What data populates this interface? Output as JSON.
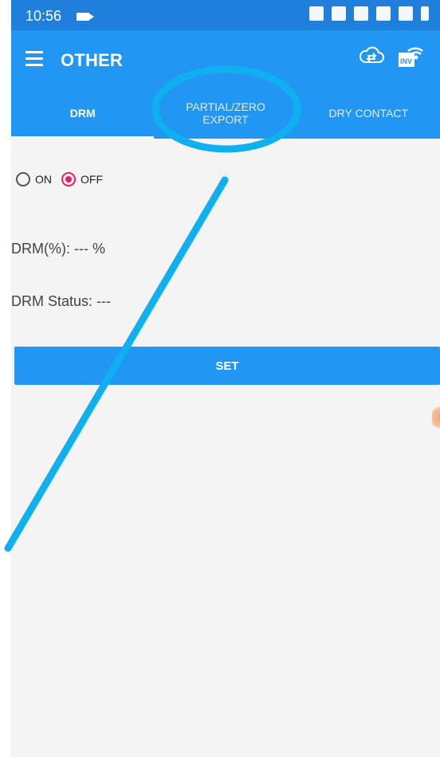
{
  "status_bar": {
    "time": "10:56"
  },
  "app_bar": {
    "title": "OTHER"
  },
  "tabs": [
    {
      "label_line1": "DRM",
      "label_line2": ""
    },
    {
      "label_line1": "PARTIAL/ZERO",
      "label_line2": "EXPORT"
    },
    {
      "label_line1": "DRY CONTACT",
      "label_line2": ""
    }
  ],
  "drm": {
    "on_label": "ON",
    "off_label": "OFF",
    "selected": "OFF",
    "drm_percent_text": "DRM(%): --- %",
    "drm_status_text": "DRM Status: ---",
    "set_label": "SET"
  },
  "colors": {
    "primary": "#2196f3",
    "status_bar": "#1f7fdb",
    "radio_selected": "#e91e63",
    "annotation": "#0fb0f0"
  },
  "icons": [
    "menu-icon",
    "cloud-sync-icon",
    "wifi-inverter-icon"
  ]
}
